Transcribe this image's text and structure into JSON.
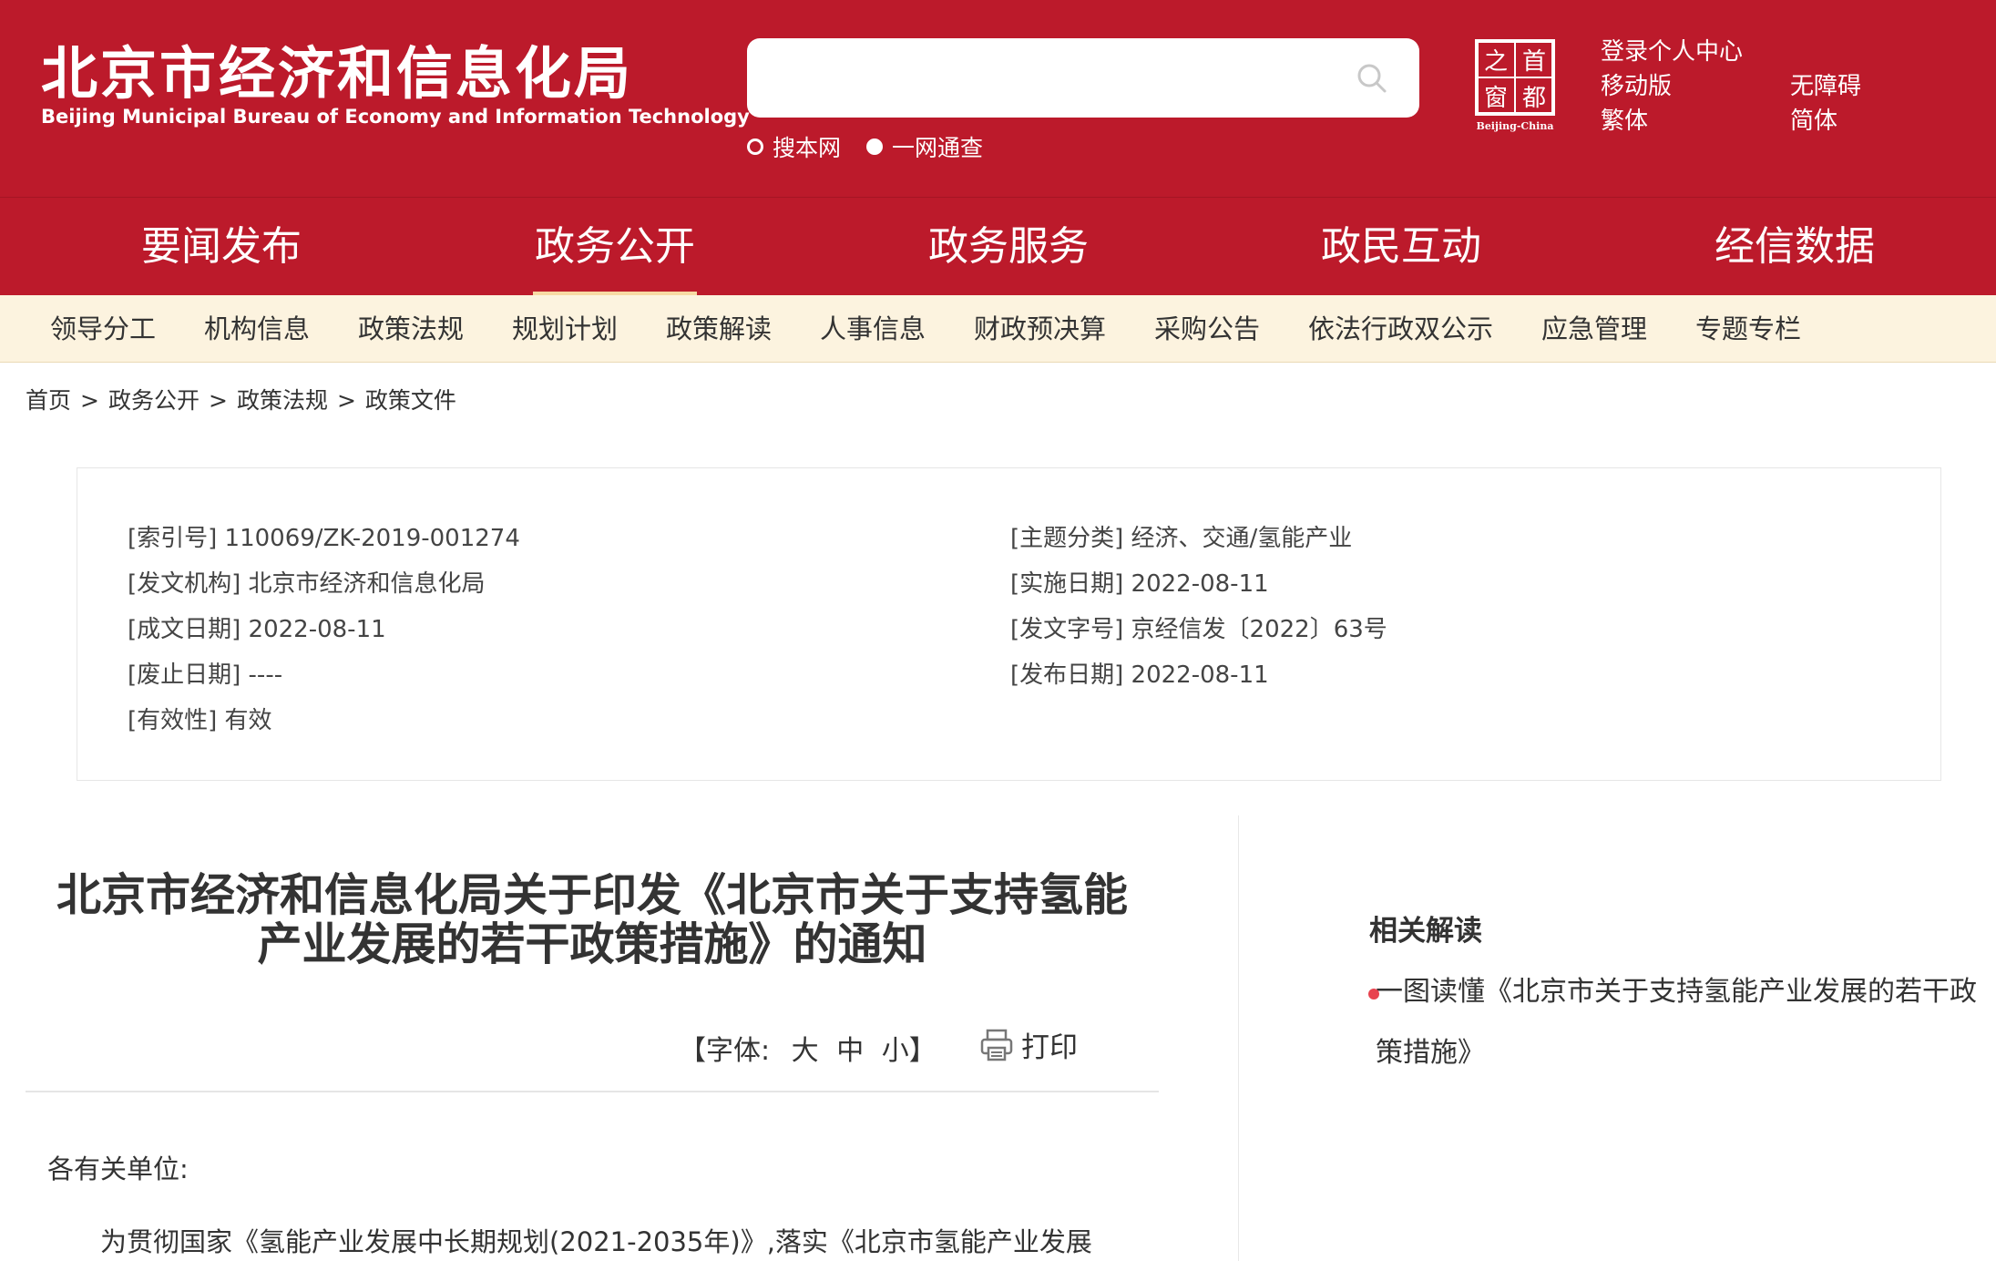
{
  "header": {
    "title_cn": "北京市经济和信息化局",
    "title_en": "Beijing Municipal Bureau of Economy and Information Technology",
    "search": {
      "value": "",
      "placeholder": ""
    },
    "scope_options": [
      "搜本网",
      "一网通查"
    ],
    "seal_text": "Beijing-China",
    "links": [
      "登录个人中心",
      "移动版",
      "繁体",
      "无障碍",
      "简体"
    ],
    "colors": {
      "brand_red": "#bc1a2b",
      "subnav_bg": "#fcf3df"
    }
  },
  "main_nav": [
    "要闻发布",
    "政务公开",
    "政务服务",
    "政民互动",
    "经信数据"
  ],
  "main_nav_active": "政务公开",
  "sub_nav": [
    "领导分工",
    "机构信息",
    "政策法规",
    "规划计划",
    "政策解读",
    "人事信息",
    "财政预决算",
    "采购公告",
    "依法行政双公示",
    "应急管理",
    "专题专栏"
  ],
  "breadcrumb": [
    "首页",
    "政务公开",
    "政策法规",
    "政策文件"
  ],
  "meta": {
    "index_no": "[索引号] 110069/ZK-2019-001274",
    "issuer": "[发文机构] 北京市经济和信息化局",
    "written_date": "[成文日期] 2022-08-11",
    "abolish_date": "[废止日期] ----",
    "validity": "[有效性] 有效",
    "topic": "[主题分类] 经济、交通/氢能产业",
    "effective_date": "[实施日期] 2022-08-11",
    "doc_no": "[发文字号] 京经信发〔2022〕63号",
    "publish_date": "[发布日期] 2022-08-11"
  },
  "article": {
    "title_line1": "北京市经济和信息化局关于印发《北京市关于支持氢能",
    "title_line2": "产业发展的若干政策措施》的通知",
    "font_label": "【字体:",
    "font_large": "大",
    "font_medium": "中",
    "font_small": "小】",
    "print_label": "打印",
    "salutation": "各有关单位:",
    "body_first_line": "为贯彻国家《氢能产业发展中长期规划(2021-2035年)》,落实《北京市氢能产业发展"
  },
  "sidebar": {
    "title": "相关解读",
    "items": [
      "一图读懂《北京市关于支持氢能产业发展的若干政策措施》"
    ]
  }
}
